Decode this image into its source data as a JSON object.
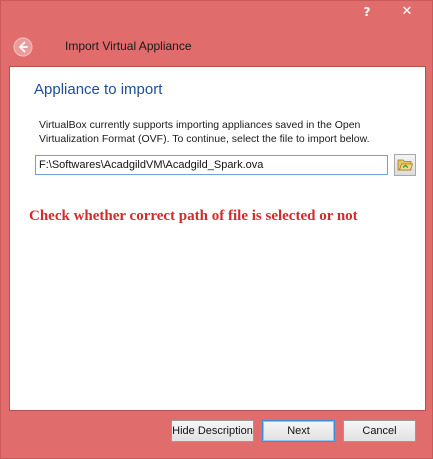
{
  "window": {
    "help_label": "?",
    "close_label": "✕"
  },
  "wizard": {
    "title": "Import Virtual Appliance",
    "back_icon": "back-arrow-icon"
  },
  "page": {
    "heading": "Appliance to import",
    "description": "VirtualBox currently supports importing appliances saved in the Open Virtualization Format (OVF). To continue, select the file to import below.",
    "file_path": "F:\\Softwares\\AcadgildVM\\Acadgild_Spark.ova",
    "browse_icon": "folder-open-icon",
    "annotation": "Check whether correct path of file is selected or not"
  },
  "buttons": {
    "hide_description": "Hide Description",
    "next": "Next",
    "cancel": "Cancel"
  },
  "colors": {
    "frame": "#e06c6c",
    "heading": "#1f4e96",
    "annotation": "#d42a2a",
    "input_border": "#6fa3d6"
  }
}
